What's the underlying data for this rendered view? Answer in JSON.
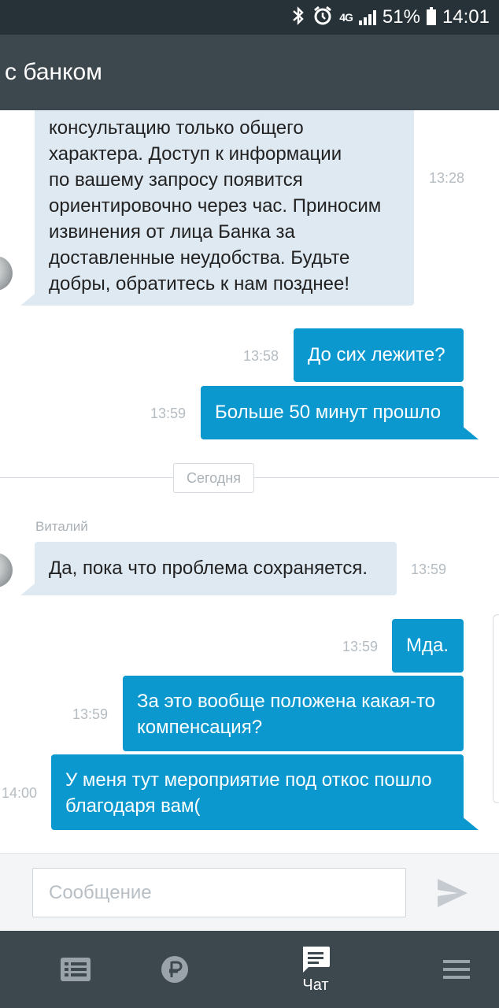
{
  "status_bar": {
    "network": "4G",
    "battery": "51%",
    "time": "14:01"
  },
  "header": {
    "title": "с банком"
  },
  "messages": [
    {
      "direction": "in",
      "text_lines": [
        "консультацию только общего",
        "характера. Доступ к информации",
        "по вашему запросу появится",
        "ориентировочно через час. Приносим",
        "извинения от лица Банка за",
        "доставленные неудобства. Будьте",
        "добры, обратитесь к нам позднее!"
      ],
      "time": "13:28"
    },
    {
      "direction": "out",
      "text": "До сих лежите?",
      "time": "13:58"
    },
    {
      "direction": "out",
      "text": "Больше 50 минут прошло",
      "time": "13:59"
    },
    {
      "direction": "in",
      "author": "Виталий",
      "text": "Да, пока что проблема сохраняется.",
      "time": "13:59"
    },
    {
      "direction": "out",
      "text": "Мда.",
      "time": "13:59"
    },
    {
      "direction": "out",
      "text_lines": [
        "За это вообще положена какая-то",
        "компенсация?"
      ],
      "time": "13:59"
    },
    {
      "direction": "out",
      "text_lines": [
        "У меня тут мероприятие под откос пошло",
        "благодаря вам("
      ],
      "time": "14:00"
    }
  ],
  "date_separator": "Сегодня",
  "composer": {
    "placeholder": "Сообщение",
    "value": ""
  },
  "bottom_nav": {
    "items": [
      {
        "icon": "list-icon",
        "label": ""
      },
      {
        "icon": "ruble-icon",
        "label": ""
      },
      {
        "icon": "chat-icon",
        "label": "Чат",
        "active": true
      },
      {
        "icon": "menu-icon",
        "label": ""
      }
    ]
  },
  "colors": {
    "outgoing_bubble": "#0a98cf",
    "incoming_bubble": "#dfe9f2",
    "app_bar": "#3d474e",
    "status_bar": "#263238"
  }
}
